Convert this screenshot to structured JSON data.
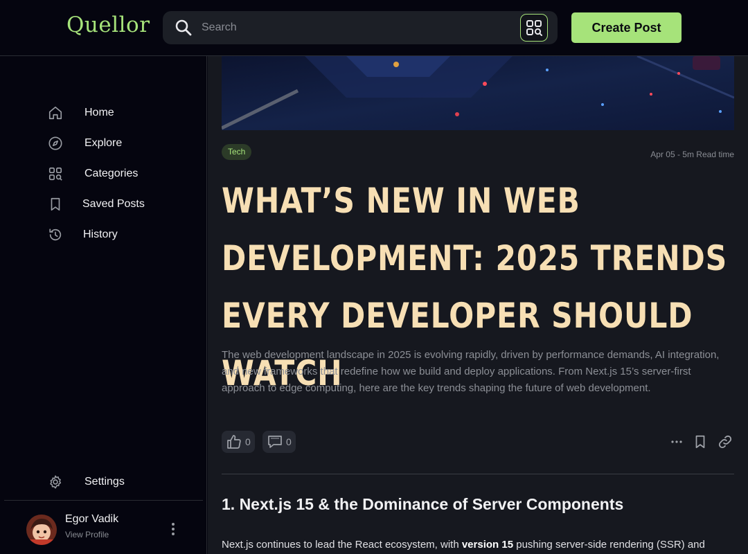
{
  "header": {
    "logo": "Quellor",
    "search_placeholder": "Search",
    "create_post_label": "Create Post"
  },
  "sidebar": {
    "items": [
      {
        "label": "Home",
        "icon": "home-icon"
      },
      {
        "label": "Explore",
        "icon": "compass-icon"
      },
      {
        "label": "Categories",
        "icon": "categories-icon"
      },
      {
        "label": "Saved Posts",
        "icon": "bookmark-icon"
      },
      {
        "label": "History",
        "icon": "history-icon"
      }
    ],
    "settings_label": "Settings",
    "profile": {
      "name": "Egor Vadik",
      "link": "View Profile"
    }
  },
  "post": {
    "tag": "Tech",
    "meta": "Apr 05 - 5m Read time",
    "title": "What’s new in web development: 2025 trends every developer should watch",
    "summary": "The web development landscape in 2025 is evolving rapidly, driven by performance demands, AI integration, and new frameworks that redefine how we build and deploy applications. From Next.js 15’s server-first approach to edge computing, here are the key trends shaping the future of web development.",
    "likes": "0",
    "comments": "0",
    "section_heading": "1. Next.js 15 & the Dominance of Server Components",
    "para_start": "Next.js continues to lead the React ecosystem, with ",
    "para_bold": "version 15",
    "para_end": " pushing server-side rendering (SSR) and"
  },
  "colors": {
    "accent": "#a6e37a",
    "title": "#f7dfb4",
    "background": "#05050f",
    "panel": "#16181f"
  }
}
